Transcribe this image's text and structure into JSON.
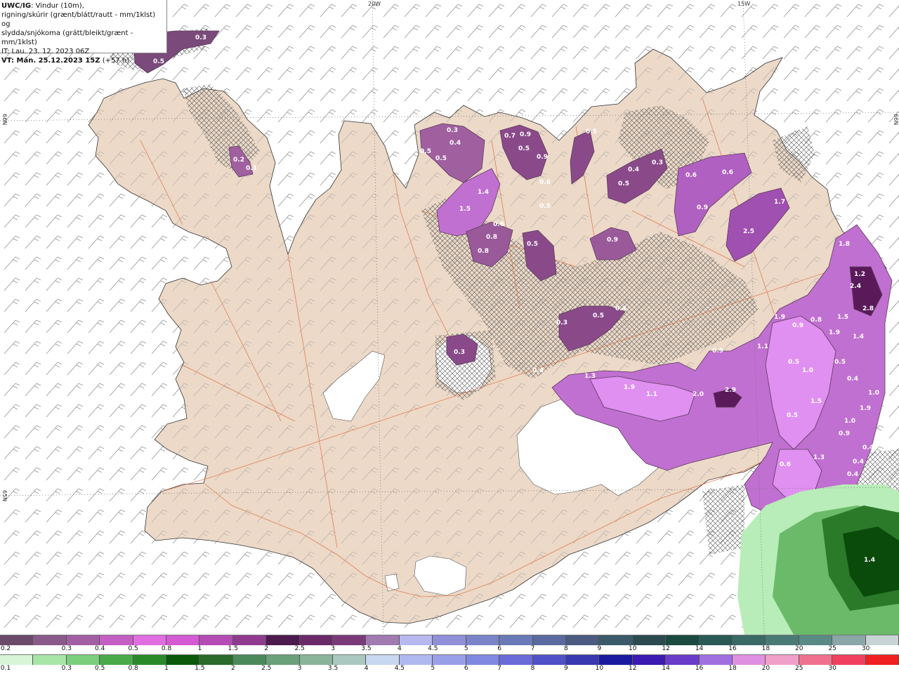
{
  "title": {
    "model": "UWC/IG",
    "line1": ": Vindur (10m),",
    "line2": "rigning/skúrir (grænt/blátt/rautt - mm/1klst) og",
    "line3": "slydda/snjókoma (grátt/bleikt/grænt - mm/1klst)",
    "it": "IT: Lau. 23. 12. 2023 06Z",
    "vt": "VT: Mán. 25.12.2023 15Z",
    "lead": "(+57 h)"
  },
  "grid_labels": {
    "lon_20w": "20W",
    "lon_15w": "15W",
    "lat_66n_left": "66N",
    "lat_66n_right": "66N",
    "lat_65n_left": "65N"
  },
  "legend": {
    "snow_colors": [
      "#6b4a6b",
      "#8a5a8a",
      "#a35fa3",
      "#c45fc4",
      "#e06ee0",
      "#d45ad4",
      "#b54bb5",
      "#8f3a8f",
      "#4d1a4d",
      "#6a2a6a",
      "#7a3a7a",
      "#a07ab0",
      "#b8b8f0",
      "#9090d8",
      "#7a84c8",
      "#6a7ab8",
      "#5a6aa0",
      "#4a5a80",
      "#3a5a6a",
      "#2a4a50",
      "#1a4a40",
      "#2a5a55",
      "#3a6a65",
      "#4a7a75",
      "#5a8a85",
      "#8aa6a6",
      "#c8d4d4"
    ],
    "snow_labels": [
      "0.2",
      "0.3",
      "0.4",
      "0.5",
      "0.8",
      "1",
      "1.5",
      "2",
      "2.5",
      "3",
      "3.5",
      "4",
      "4.5",
      "5",
      "6",
      "7",
      "8",
      "9",
      "10",
      "12",
      "14",
      "16",
      "18",
      "20",
      "25",
      "30"
    ],
    "rain_colors": [
      "#d8f5d8",
      "#a8e6a8",
      "#7ccf7c",
      "#4aaa4a",
      "#2a8a2a",
      "#0a5a0a",
      "#2a6a2a",
      "#4a8a5a",
      "#6aa07a",
      "#8ab49a",
      "#aac8c0",
      "#c8d8f0",
      "#b0b8f0",
      "#9aa0e8",
      "#8088e0",
      "#6a6ad8",
      "#5050c8",
      "#3838b0",
      "#1a1aa0",
      "#3a1ab0",
      "#6a3ac8",
      "#a070e0",
      "#e090e0",
      "#f0a0c8",
      "#f07090",
      "#f04060",
      "#f02020"
    ],
    "rain_labels": [
      "0.1",
      "0.3",
      "0.5",
      "0.8",
      "1",
      "1.5",
      "2",
      "2.5",
      "3",
      "3.5",
      "4",
      "4.5",
      "5",
      "6",
      "7",
      "8",
      "9",
      "10",
      "12",
      "14",
      "16",
      "18",
      "20",
      "25",
      "30"
    ]
  },
  "precip_values": [
    {
      "v": "0.3"
    },
    {
      "v": "0.5"
    },
    {
      "v": "0.2"
    },
    {
      "v": "0.1"
    },
    {
      "v": "0.3"
    },
    {
      "v": "0.4"
    },
    {
      "v": "0.5"
    },
    {
      "v": "0.5"
    },
    {
      "v": "0.7"
    },
    {
      "v": "0.9"
    },
    {
      "v": "0.5"
    },
    {
      "v": "0.9"
    },
    {
      "v": "0.6"
    },
    {
      "v": "0.5"
    },
    {
      "v": "0.4"
    },
    {
      "v": "0.3"
    },
    {
      "v": "0.6"
    },
    {
      "v": "0.6"
    },
    {
      "v": "1.4"
    },
    {
      "v": "1.5"
    },
    {
      "v": "0.5"
    },
    {
      "v": "0.5"
    },
    {
      "v": "0.9"
    },
    {
      "v": "1.7"
    },
    {
      "v": "2.5"
    },
    {
      "v": "0.6"
    },
    {
      "v": "0.8"
    },
    {
      "v": "0.8"
    },
    {
      "v": "0.5"
    },
    {
      "v": "0.9"
    },
    {
      "v": "1.8"
    },
    {
      "v": "1.2"
    },
    {
      "v": "2.4"
    },
    {
      "v": "2.8"
    },
    {
      "v": "0.4"
    },
    {
      "v": "0.5"
    },
    {
      "v": "0.3"
    },
    {
      "v": "1.9"
    },
    {
      "v": "0.9"
    },
    {
      "v": "0.8"
    },
    {
      "v": "1.9"
    },
    {
      "v": "1.5"
    },
    {
      "v": "1.4"
    },
    {
      "v": "0.3"
    },
    {
      "v": "0.4"
    },
    {
      "v": "1.3"
    },
    {
      "v": "1.9"
    },
    {
      "v": "1.1"
    },
    {
      "v": "2.0"
    },
    {
      "v": "2.9"
    },
    {
      "v": "0.9"
    },
    {
      "v": "1.1"
    },
    {
      "v": "0.5"
    },
    {
      "v": "1.0"
    },
    {
      "v": "0.5"
    },
    {
      "v": "0.4"
    },
    {
      "v": "1.0"
    },
    {
      "v": "1.9"
    },
    {
      "v": "1.5"
    },
    {
      "v": "0.5"
    },
    {
      "v": "1.0"
    },
    {
      "v": "0.9"
    },
    {
      "v": "0.6"
    },
    {
      "v": "1.3"
    },
    {
      "v": "0.4"
    },
    {
      "v": "0.4"
    },
    {
      "v": "0.4"
    },
    {
      "v": "1.4"
    }
  ]
}
